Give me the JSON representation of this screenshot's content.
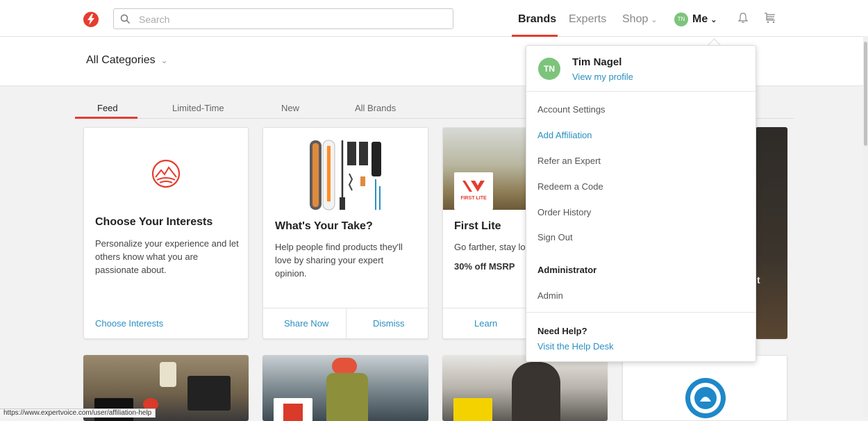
{
  "header": {
    "search_placeholder": "Search",
    "nav": {
      "brands": "Brands",
      "experts": "Experts",
      "shop": "Shop",
      "me": "Me"
    },
    "avatar_initials": "TN",
    "brand_color": "#e63c2f"
  },
  "subheader": {
    "category_label": "All Categories"
  },
  "tabs": [
    "Feed",
    "Limited-Time",
    "New",
    "All Brands"
  ],
  "cards": {
    "interests": {
      "title": "Choose Your Interests",
      "text": "Personalize your experience and let others know what you are passionate about.",
      "link": "Choose Interests"
    },
    "take": {
      "title": "What's Your Take?",
      "text": "Help people find products they'll love by sharing your expert opinion.",
      "primary": "Share Now",
      "secondary": "Dismiss"
    },
    "firstlite": {
      "title": "First Lite",
      "text": "Go farther, stay lon",
      "offer": "30% off MSRP",
      "logo_text": "FIRST LITE",
      "link": "Learn"
    }
  },
  "dropdown": {
    "initials": "TN",
    "name": "Tim Nagel",
    "profile_link": "View my profile",
    "items": [
      "Account Settings",
      "Add Affiliation",
      "Refer an Expert",
      "Redeem a Code",
      "Order History",
      "Sign Out"
    ],
    "admin_heading": "Administrator",
    "admin_item": "Admin",
    "help_heading": "Need Help?",
    "help_link": "Visit the Help Desk"
  },
  "status_url": "https://www.expertvoice.com/user/affiliation-help",
  "icons": [
    "logo-icon",
    "search-icon",
    "bell-icon",
    "cart-icon",
    "mountain-icon"
  ]
}
